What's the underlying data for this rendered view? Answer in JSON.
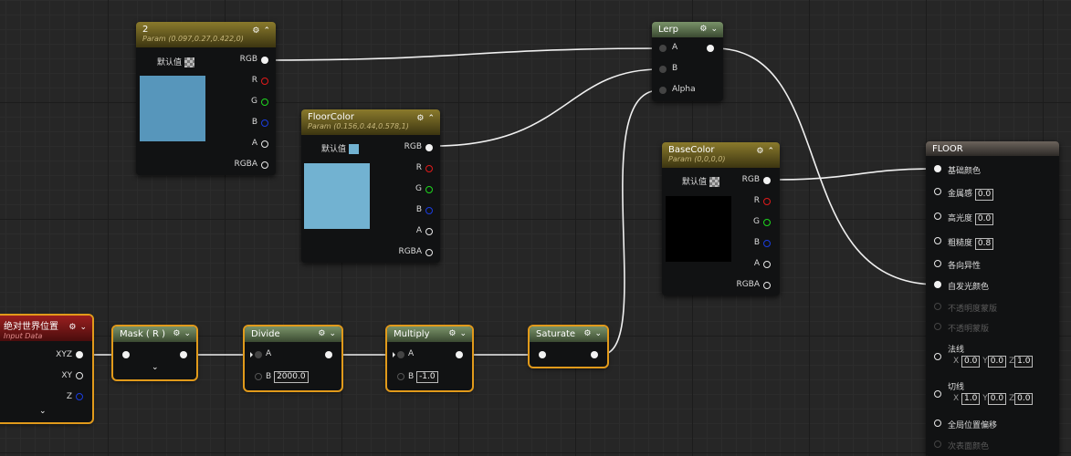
{
  "colors": {
    "accent": "#e19a1b",
    "param_header": "#8a7a2c",
    "math_header": "#7a9369",
    "input_header": "#9a1f1f",
    "r_pin": "#e01a1a",
    "g_pin": "#1ed61e",
    "b_pin": "#1a3de0"
  },
  "node_param2": {
    "title": "2",
    "subtitle": "Param (0.097,0.27,0.422,0)",
    "default_label": "默认值",
    "swatch": "#5796bb",
    "pins": [
      "RGB",
      "R",
      "G",
      "B",
      "A",
      "RGBA"
    ]
  },
  "node_floorcolor": {
    "title": "FloorColor",
    "subtitle": "Param (0.156,0.44,0.578,1)",
    "default_label": "默认值",
    "swatch": "#72b2d1",
    "pins": [
      "RGB",
      "R",
      "G",
      "B",
      "A",
      "RGBA"
    ]
  },
  "node_basecolor": {
    "title": "BaseColor",
    "subtitle": "Param (0,0,0,0)",
    "default_label": "默认值",
    "swatch": "#000000",
    "pins": [
      "RGB",
      "R",
      "G",
      "B",
      "A",
      "RGBA"
    ]
  },
  "node_lerp": {
    "title": "Lerp",
    "pins": [
      "A",
      "B",
      "Alpha"
    ]
  },
  "node_worldpos": {
    "title": "绝对世界位置",
    "subtitle": "Input Data",
    "pins": [
      "XYZ",
      "XY",
      "Z"
    ]
  },
  "node_mask": {
    "title": "Mask ( R )"
  },
  "node_divide": {
    "title": "Divide",
    "pin_a": "A",
    "pin_b": "B",
    "b_value": "2000.0"
  },
  "node_multiply": {
    "title": "Multiply",
    "pin_a": "A",
    "pin_b": "B",
    "b_value": "-1.0"
  },
  "node_saturate": {
    "title": "Saturate"
  },
  "node_floor": {
    "title": "FLOOR",
    "inputs": [
      {
        "label": "基础颜色",
        "value": ""
      },
      {
        "label": "金属感",
        "value": "0.0"
      },
      {
        "label": "高光度",
        "value": "0.0"
      },
      {
        "label": "粗糙度",
        "value": "0.8"
      },
      {
        "label": "各向异性",
        "value": ""
      },
      {
        "label": "自发光颜色",
        "value": ""
      },
      {
        "label": "不透明度蒙版",
        "value": ""
      },
      {
        "label": "不透明蒙版",
        "value": ""
      }
    ],
    "normal": {
      "label": "法线",
      "x_label": "X",
      "y_label": "Y",
      "z_label": "Z",
      "x": "0.0",
      "y": "0.0",
      "z": "1.0"
    },
    "tangent": {
      "label": "切线",
      "x_label": "X",
      "y_label": "Y",
      "z_label": "Z",
      "x": "1.0",
      "y": "0.0",
      "z": "0.0"
    },
    "world_offset": "全局位置偏移",
    "subsurface": "次表面颜色"
  }
}
